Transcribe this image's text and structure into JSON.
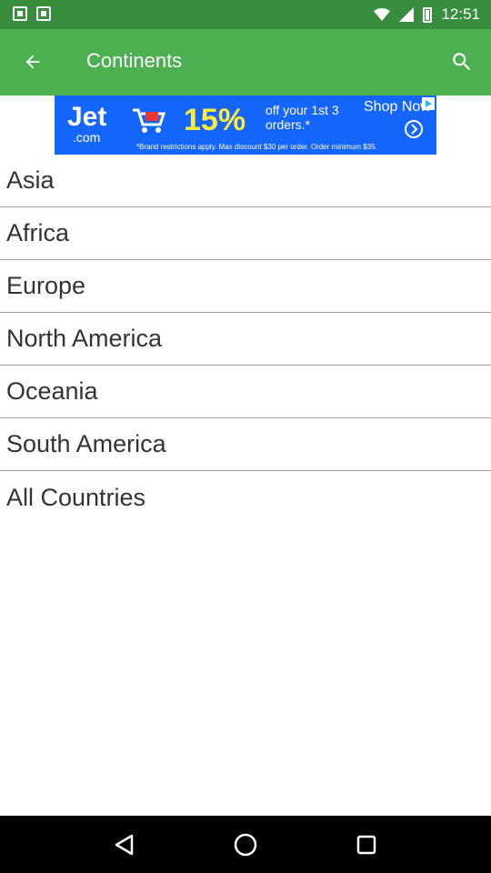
{
  "status_bar": {
    "time": "12:51",
    "icons": [
      "notification-icon",
      "notification-icon",
      "wifi-icon",
      "signal-icon",
      "battery-icon"
    ]
  },
  "app_bar": {
    "title": "Continents",
    "back_icon": "arrow-left-icon",
    "search_icon": "search-icon",
    "color": "#4caf50",
    "status_color": "#388e3c"
  },
  "ad": {
    "logo": "Jet",
    "logo_sub": ".com",
    "percent": "15%",
    "offer": "off your 1st 3 orders.*",
    "cta": "Shop Now",
    "fine_print": "*Brand restrictions apply. Max discount $30 per order. Order minimum $35.",
    "color": "#1565ff"
  },
  "continents": [
    {
      "label": "Asia"
    },
    {
      "label": "Africa"
    },
    {
      "label": "Europe"
    },
    {
      "label": "North America"
    },
    {
      "label": "Oceania"
    },
    {
      "label": "South America"
    },
    {
      "label": "All Countries"
    }
  ],
  "nav_bar": {
    "icons": [
      "back-triangle-icon",
      "home-circle-icon",
      "recents-square-icon"
    ]
  }
}
